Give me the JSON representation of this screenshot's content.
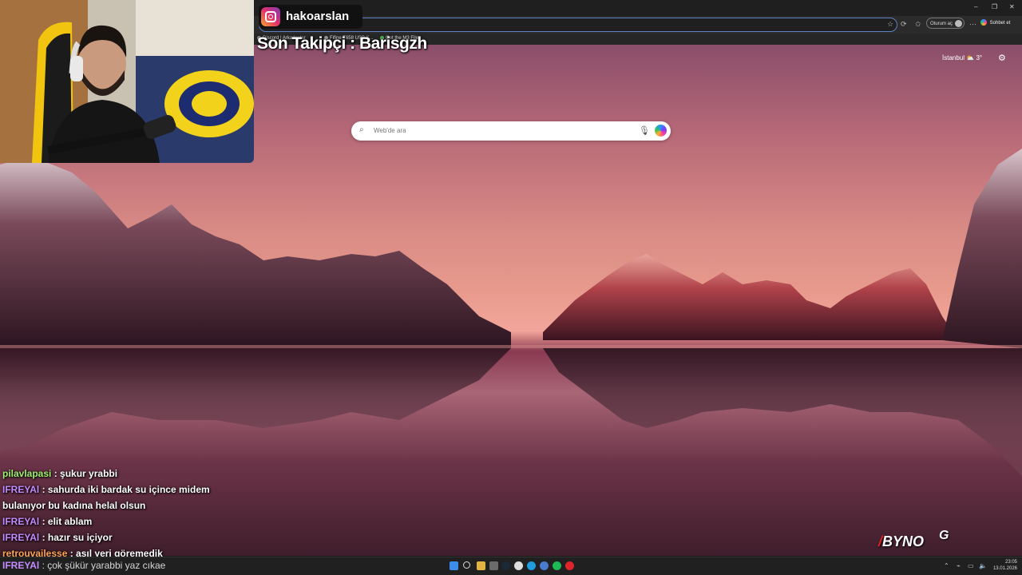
{
  "overlay": {
    "instagram_handle": "hakoarslan",
    "follower_banner": "Son Takipçi : Barisgzh",
    "brand_logo": "BYNO",
    "brand_logo_badge": "G"
  },
  "browser": {
    "window_controls": {
      "minimize": "–",
      "restore": "❐",
      "close": "✕"
    },
    "signin_label": "Oturum aç",
    "chat_label": "Sohbet et",
    "favorites": [
      {
        "label": "Discord | Arkadaşlar"
      },
      {
        "label": "Fifine T658 USB K..."
      },
      {
        "label": "Get the M3 File..."
      }
    ]
  },
  "newtab": {
    "weather_city": "İstanbul",
    "weather_temp": "3°",
    "search_placeholder": "Web'de ara"
  },
  "chat": {
    "messages": [
      {
        "user": "pilavlapasi",
        "color": "green",
        "text": " : şukur yrabbi"
      },
      {
        "user": "IFREYAl",
        "color": "purple",
        "text": " : sahurda iki bardak su içince midem bulanıyor bu kadına helal olsun"
      },
      {
        "user": "IFREYAl",
        "color": "purple",
        "text": " : elit ablam"
      },
      {
        "user": "IFREYAl",
        "color": "purple",
        "text": " : hazır su içiyor"
      },
      {
        "user": "retrouvailesse",
        "color": "orange",
        "text": " : asıl yeri göremedik"
      }
    ],
    "partial_message": {
      "user": "IFREYAl",
      "text": ": çok şükür yarabbi yaz cıkae"
    }
  },
  "taskbar": {
    "clock_time": "23:05",
    "clock_date": "13.01.2026",
    "icons": [
      "windows-start-icon",
      "search-icon",
      "file-explorer-icon",
      "browser-icon",
      "steam-icon",
      "edge-icon",
      "chrome-icon",
      "spotify-icon",
      "opera-icon"
    ]
  },
  "colors": {
    "username_green": "#9ef06e",
    "username_purple": "#c58bff",
    "username_orange": "#ffa552",
    "accent_blue": "#5d82c4"
  }
}
